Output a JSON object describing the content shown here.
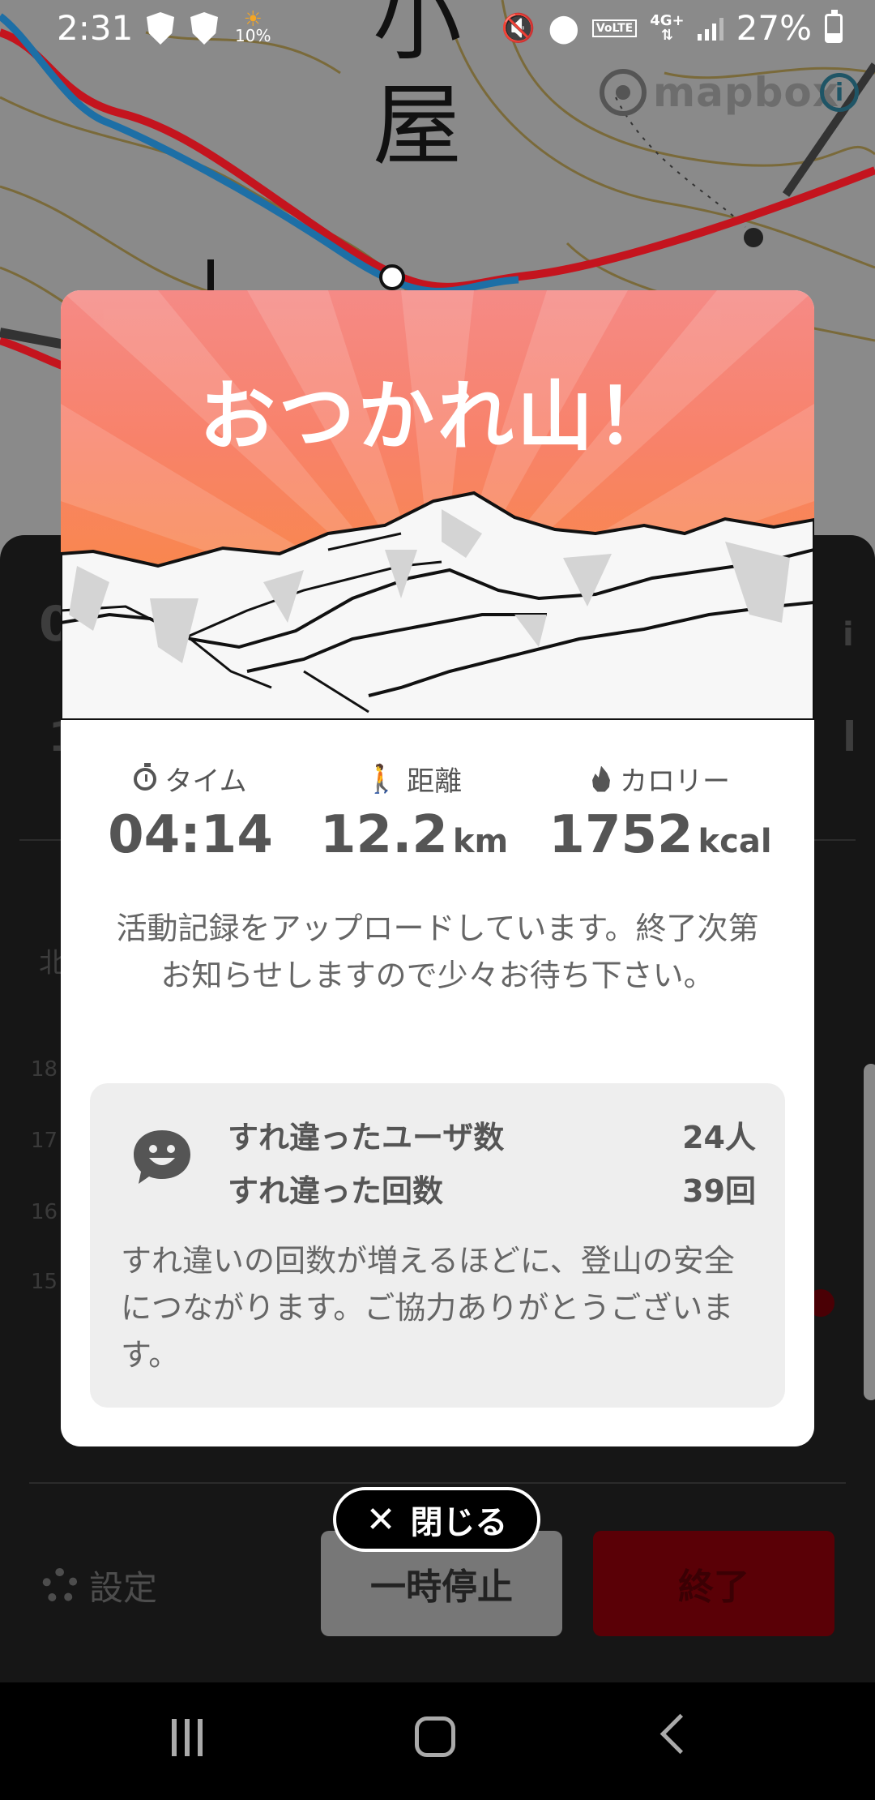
{
  "status_bar": {
    "time": "2:31",
    "weather_percent": "10%",
    "network_volte": "VoLTE",
    "network_type": "4G+",
    "battery_percent": "27%",
    "battery_level": 0.27
  },
  "map": {
    "hut_label": [
      "小",
      "屋"
    ],
    "attribution": "mapbox",
    "info_icon": "info-icon"
  },
  "dialog": {
    "title": "おつかれ山！",
    "stats": [
      {
        "label": "タイム",
        "value": "04:14",
        "unit": "",
        "icon": "timer-icon"
      },
      {
        "label": "距離",
        "value": "12.2",
        "unit": "km",
        "icon": "walking-icon"
      },
      {
        "label": "カロリー",
        "value": "1752",
        "unit": "kcal",
        "icon": "flame-icon"
      }
    ],
    "upload_message": "活動記録をアップロードしています。終了次第お知らせしますので少々お待ち下さい。",
    "passing": {
      "users_label": "すれ違ったユーザ数",
      "users_value": "24人",
      "count_label": "すれ違った回数",
      "count_value": "39回",
      "note": "すれ違いの回数が増えるほどに、登山の安全につながります。ご協力ありがとうございます。"
    }
  },
  "close_button": {
    "label": "閉じる"
  },
  "background_screen": {
    "settings_label": "設定",
    "pause_label": "一時停止",
    "end_label": "終了",
    "chart_ticks": [
      "18",
      "17",
      "16",
      "15"
    ]
  },
  "colors": {
    "hero_top": "#f58a86",
    "hero_bottom": "#f78c45",
    "end_button": "#5a0006"
  }
}
